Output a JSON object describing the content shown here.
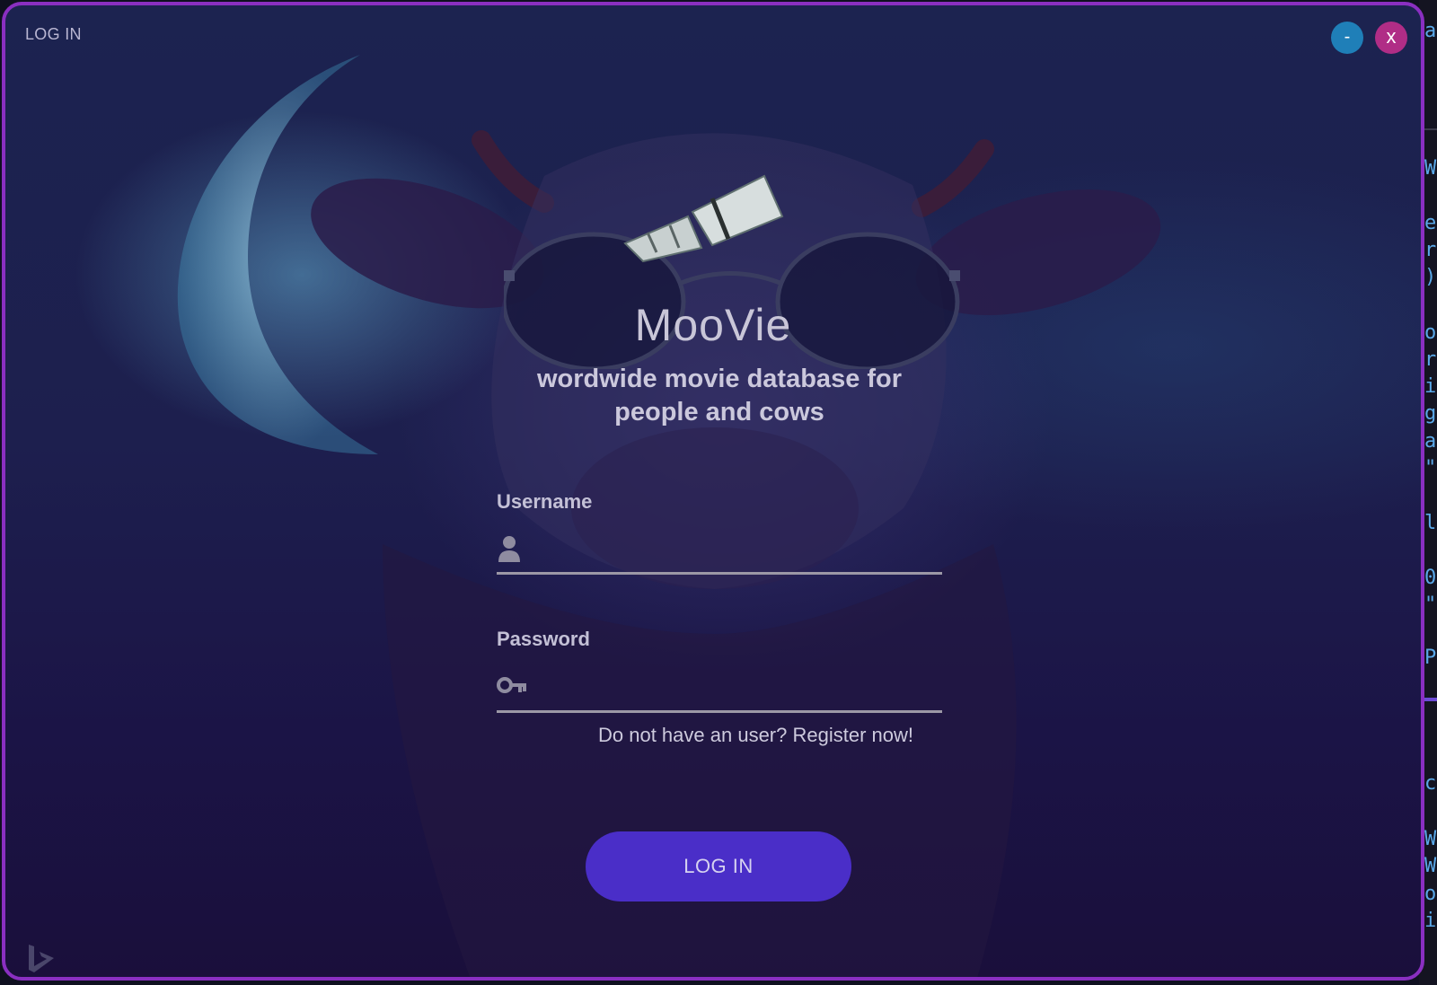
{
  "window": {
    "title": "LOG IN",
    "minimize_label": "-",
    "close_label": "x"
  },
  "brand": {
    "name": "MooVie",
    "tagline": "wordwide movie database for people and cows"
  },
  "form": {
    "username": {
      "label": "Username",
      "value": "",
      "icon": "user-icon"
    },
    "password": {
      "label": "Password",
      "value": "",
      "icon": "key-icon"
    },
    "register_text": "Do not have an user? Register now!",
    "submit_label": "LOG IN"
  },
  "colors": {
    "accent": "#4a2ec8",
    "window_border": "#8a2fc1",
    "minimize": "#1f7fb8",
    "close": "#b02d86"
  },
  "background_editor": {
    "chars": [
      "a",
      "W",
      "e",
      "r",
      ")",
      "o",
      "r",
      "i",
      "g",
      "a",
      "\"",
      "l",
      "0",
      "\"",
      "P",
      "c",
      "W",
      "W",
      "o",
      "i"
    ]
  }
}
